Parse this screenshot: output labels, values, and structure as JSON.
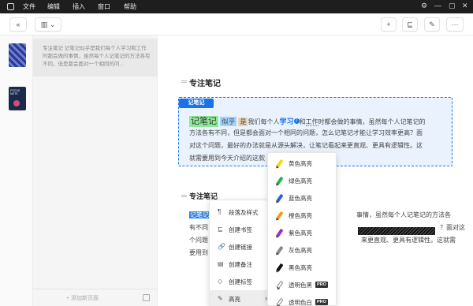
{
  "menubar": {
    "items": [
      "文件",
      "编辑",
      "插入",
      "窗口",
      "帮助"
    ],
    "window_buttons": [
      "⚙",
      "—",
      "▢",
      "✕"
    ]
  },
  "toolbar": {
    "collapse": "«",
    "layout": "▥",
    "layout_dropdown": "⌄",
    "add": "+",
    "bookmark": "⊑",
    "magic": "✎",
    "more": "···"
  },
  "sidebar": {
    "thumb2_text": "FOCUS NOTE",
    "page_card_text": "专注笔记 记笔记似乎是我们每个人学习和工作时都会做的事情，虽然每个人记笔记的方法各有不同，但是都会面对一个相同的问…",
    "add_page": "+ 添加新页面"
  },
  "doc": {
    "heading1": "专注笔记",
    "note_tag": "记笔记",
    "note_words": [
      "记笔记",
      "似乎",
      "是",
      "我们每个人",
      "学习",
      "1",
      "和",
      "工作",
      "时都会做的事情，虽然每个人记笔记的"
    ],
    "note_line2": "方法各有不同，但是都会面对一个相同的问题，怎么记笔记才能让学习效率更高？面",
    "note_line3": "对这个问题，最好的办法就是从源头解决，让笔记看起来更直观、更具有逻辑性。这",
    "note_line4": "就需要用到今天介绍的这款",
    "heading2": "专注笔记",
    "body_sel": "记笔记",
    "body1_right": "事情，虽然每个人记笔记的方法各",
    "body2_left": "有不同",
    "body2_right": "？面对这",
    "body3_left": "个问题",
    "body3_right": "来更直观、更具有逻辑性。这就需",
    "body4_left": "要用到"
  },
  "context_menu": {
    "items": [
      {
        "label": "段落及样式",
        "icon": "¶"
      },
      {
        "label": "创建书签",
        "icon": "⊑"
      },
      {
        "label": "创建链接",
        "icon": "🔗"
      },
      {
        "label": "创建备注",
        "icon": "▤"
      },
      {
        "label": "创建标签",
        "icon": "◇"
      },
      {
        "label": "高亮",
        "icon": "✎",
        "arrow": "›"
      }
    ]
  },
  "highlight_menu": {
    "items": [
      {
        "label": "黄色高亮",
        "color": "#f5d90a"
      },
      {
        "label": "绿色高亮",
        "color": "#27b34a"
      },
      {
        "label": "蓝色高亮",
        "color": "#2e5fe8"
      },
      {
        "label": "橙色高亮",
        "color": "#f59a1a"
      },
      {
        "label": "紫色高亮",
        "color": "#9b2bd6"
      },
      {
        "label": "灰色高亮",
        "color": "#8a8a8a"
      },
      {
        "label": "黑色高亮",
        "color": "#111111"
      },
      {
        "label": "透明色黑",
        "color": "outline",
        "badge": "PRO"
      },
      {
        "label": "透明色白",
        "color": "outline",
        "badge": "PRO"
      }
    ]
  }
}
